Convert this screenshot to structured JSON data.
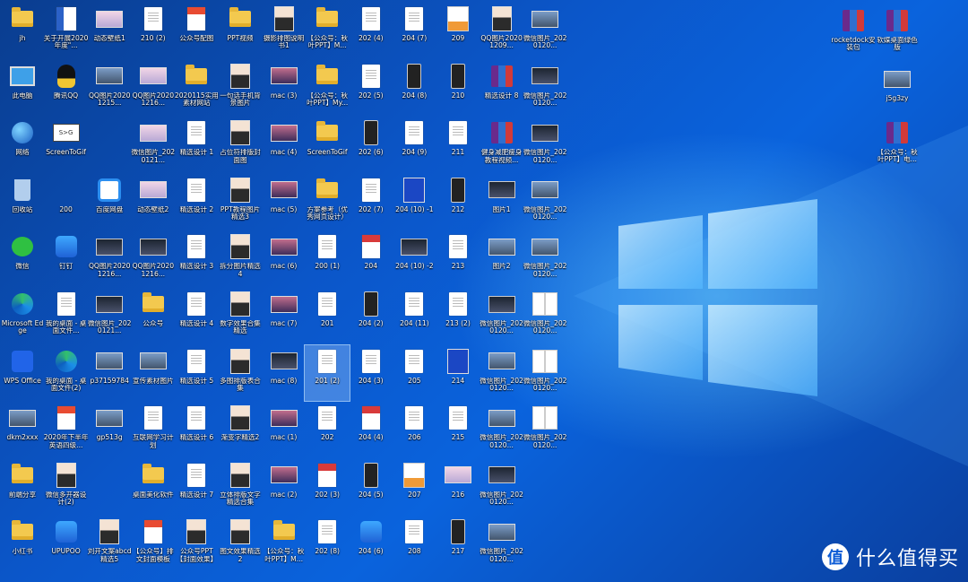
{
  "watermark": {
    "logo_text": "值",
    "text": "什么值得买"
  },
  "desktop": {
    "columns": [
      {
        "x": 0,
        "items": [
          {
            "label": "jh",
            "icon": "folder"
          },
          {
            "label": "此电脑",
            "icon": "pc"
          },
          {
            "label": "网络",
            "icon": "globe"
          },
          {
            "label": "回收站",
            "icon": "recycle"
          },
          {
            "label": "微信",
            "icon": "wechat"
          },
          {
            "label": "Microsoft Edge",
            "icon": "edge"
          },
          {
            "label": "WPS Office",
            "icon": "wpsapp"
          },
          {
            "label": "dkm2xxx",
            "icon": "wide"
          },
          {
            "label": "前端分享",
            "icon": "folder"
          },
          {
            "label": "小红书",
            "icon": "folder"
          }
        ]
      },
      {
        "x": 1,
        "items": [
          {
            "label": "关于开展2020年度\"...",
            "icon": "word"
          },
          {
            "label": "腾讯QQ",
            "icon": "qq"
          },
          {
            "label": "ScreenToGif",
            "icon": "gif"
          },
          {
            "label": "200",
            "icon": "none"
          },
          {
            "label": "钉钉",
            "icon": "app"
          },
          {
            "label": "我的桌面 - 桌面文件...",
            "icon": "doc"
          },
          {
            "label": "我的桌面 - 桌面文件(2)",
            "icon": "edge"
          },
          {
            "label": "2020年下半年英语四级...",
            "icon": "wps"
          },
          {
            "label": "微信多开器设计(2)",
            "icon": "person"
          },
          {
            "label": "UPUPOO",
            "icon": "app"
          }
        ]
      },
      {
        "x": 2,
        "items": [
          {
            "label": "动态壁纸1",
            "icon": "pink"
          },
          {
            "label": "QQ图片2020121​5...",
            "icon": "wide"
          },
          {
            "label": "",
            "icon": "none"
          },
          {
            "label": "百度网盘",
            "icon": "baidu"
          },
          {
            "label": "QQ图片2020121​6...",
            "icon": "dark"
          },
          {
            "label": "微信图片_2020121...",
            "icon": "dark"
          },
          {
            "label": "p37159784",
            "icon": "wide"
          },
          {
            "label": "gp513g",
            "icon": "wide"
          },
          {
            "label": "",
            "icon": "none"
          },
          {
            "label": "刘开文案abcd精选5",
            "icon": "person"
          }
        ]
      },
      {
        "x": 3,
        "items": [
          {
            "label": "210 (2)",
            "icon": "doc"
          },
          {
            "label": "QQ图片2020121​6...",
            "icon": "pink"
          },
          {
            "label": "微信图片_2020121...",
            "icon": "pink"
          },
          {
            "label": "动态壁纸2",
            "icon": "pink"
          },
          {
            "label": "QQ图片2020121​6...",
            "icon": "dark"
          },
          {
            "label": "公众号",
            "icon": "folder"
          },
          {
            "label": "宣传素材图片",
            "icon": "wide"
          },
          {
            "label": "互联网学习计划",
            "icon": "doc"
          },
          {
            "label": "桌面美化软件",
            "icon": "folder"
          },
          {
            "label": "【公众号】排文封面模板",
            "icon": "wps"
          }
        ]
      },
      {
        "x": 4,
        "items": [
          {
            "label": "公众号配图",
            "icon": "wps"
          },
          {
            "label": "2020115实用素材网站",
            "icon": "folder"
          },
          {
            "label": "精选设计 1",
            "icon": "doc"
          },
          {
            "label": "精选设计 2",
            "icon": "doc"
          },
          {
            "label": "精选设计 3",
            "icon": "doc"
          },
          {
            "label": "精选设计 4",
            "icon": "doc"
          },
          {
            "label": "精选设计 5",
            "icon": "doc"
          },
          {
            "label": "精选设计 6",
            "icon": "doc"
          },
          {
            "label": "精选设计 7",
            "icon": "doc"
          },
          {
            "label": "公众号PPT【封面效果】",
            "icon": "person"
          }
        ]
      },
      {
        "x": 5,
        "items": [
          {
            "label": "PPT视频",
            "icon": "folder"
          },
          {
            "label": "一句话手机背景图片",
            "icon": "person"
          },
          {
            "label": "占位符排版封面图",
            "icon": "person"
          },
          {
            "label": "PPT教程图片精选3",
            "icon": "person"
          },
          {
            "label": "拆分图片精选4",
            "icon": "person"
          },
          {
            "label": "数字效果合集精选",
            "icon": "person"
          },
          {
            "label": "多图排版表合集",
            "icon": "person"
          },
          {
            "label": "渐变字精选2",
            "icon": "person"
          },
          {
            "label": "立体排版文字精选合集",
            "icon": "person"
          },
          {
            "label": "图文效果精选2",
            "icon": "person"
          }
        ]
      },
      {
        "x": 6,
        "items": [
          {
            "label": "摄影排图说明书1",
            "icon": "person"
          },
          {
            "label": "mac (3)",
            "icon": "mac"
          },
          {
            "label": "mac (4)",
            "icon": "mac"
          },
          {
            "label": "mac (5)",
            "icon": "mac"
          },
          {
            "label": "mac (6)",
            "icon": "mac"
          },
          {
            "label": "mac (7)",
            "icon": "mac"
          },
          {
            "label": "mac (8)",
            "icon": "dark"
          },
          {
            "label": "mac (1)",
            "icon": "mac"
          },
          {
            "label": "mac (2)",
            "icon": "mac"
          },
          {
            "label": "【公众号：秋叶PPT】M...",
            "icon": "folder"
          }
        ]
      },
      {
        "x": 7,
        "items": [
          {
            "label": "【公众号：秋叶PPT】M...",
            "icon": "folder"
          },
          {
            "label": "【公众号：秋叶PPT】My...",
            "icon": "folder"
          },
          {
            "label": "ScreenToGif",
            "icon": "folder"
          },
          {
            "label": "方案参考（优秀网页设计）",
            "icon": "folder"
          },
          {
            "label": "200 (1)",
            "icon": "doc"
          },
          {
            "label": "201",
            "icon": "doc"
          },
          {
            "label": "201 (2)",
            "icon": "doc",
            "selected": true
          },
          {
            "label": "202",
            "icon": "doc"
          },
          {
            "label": "202 (3)",
            "icon": "red"
          },
          {
            "label": "202 (8)",
            "icon": "doc"
          }
        ]
      },
      {
        "x": 8,
        "items": [
          {
            "label": "202 (4)",
            "icon": "doc"
          },
          {
            "label": "202 (5)",
            "icon": "doc"
          },
          {
            "label": "202 (6)",
            "icon": "phone"
          },
          {
            "label": "202 (7)",
            "icon": "doc"
          },
          {
            "label": "204",
            "icon": "red"
          },
          {
            "label": "204 (2)",
            "icon": "phone"
          },
          {
            "label": "204 (3)",
            "icon": "doc"
          },
          {
            "label": "204 (4)",
            "icon": "red"
          },
          {
            "label": "204 (5)",
            "icon": "phone"
          },
          {
            "label": "204 (6)",
            "icon": "app"
          }
        ]
      },
      {
        "x": 9,
        "items": [
          {
            "label": "204 (7)",
            "icon": "doc"
          },
          {
            "label": "204 (8)",
            "icon": "phone"
          },
          {
            "label": "204 (9)",
            "icon": "doc"
          },
          {
            "label": "204 (10) -1",
            "icon": "blue"
          },
          {
            "label": "204 (10) -2",
            "icon": "dark"
          },
          {
            "label": "204 (11)",
            "icon": "doc"
          },
          {
            "label": "205",
            "icon": "doc"
          },
          {
            "label": "206",
            "icon": "doc"
          },
          {
            "label": "207",
            "icon": "orange"
          },
          {
            "label": "208",
            "icon": "doc"
          }
        ]
      },
      {
        "x": 10,
        "items": [
          {
            "label": "209",
            "icon": "orange"
          },
          {
            "label": "210",
            "icon": "phone"
          },
          {
            "label": "211",
            "icon": "doc"
          },
          {
            "label": "212",
            "icon": "phone"
          },
          {
            "label": "213",
            "icon": "doc"
          },
          {
            "label": "213 (2)",
            "icon": "doc"
          },
          {
            "label": "214",
            "icon": "blue"
          },
          {
            "label": "215",
            "icon": "doc"
          },
          {
            "label": "216",
            "icon": "pink"
          },
          {
            "label": "217",
            "icon": "phone"
          }
        ]
      },
      {
        "x": 11,
        "items": [
          {
            "label": "QQ图片2020120​9...",
            "icon": "person"
          },
          {
            "label": "精选设计 8",
            "icon": "zip"
          },
          {
            "label": "健身减肥瘦身教程视频...",
            "icon": "zip"
          },
          {
            "label": "图片1",
            "icon": "dark"
          },
          {
            "label": "图片2",
            "icon": "wide"
          },
          {
            "label": "微信图片_2020120...",
            "icon": "dark"
          },
          {
            "label": "微信图片_2020120...",
            "icon": "wide"
          },
          {
            "label": "微信图片_2020120...",
            "icon": "wide"
          },
          {
            "label": "微信图片_2020120...",
            "icon": "dark"
          },
          {
            "label": "微信图片_2020120...",
            "icon": "wide"
          }
        ]
      },
      {
        "x": 12,
        "items": [
          {
            "label": "微信图片_2020120...",
            "icon": "wide"
          },
          {
            "label": "微信图片_2020120...",
            "icon": "dark"
          },
          {
            "label": "微信图片_2020120...",
            "icon": "dark"
          },
          {
            "label": "微信图片_2020120...",
            "icon": "wide"
          },
          {
            "label": "微信图片_2020120...",
            "icon": "wide"
          },
          {
            "label": "微信图片_2020120...",
            "icon": "grid"
          },
          {
            "label": "微信图片_2020120...",
            "icon": "grid"
          },
          {
            "label": "微信图片_2020120...",
            "icon": "grid"
          }
        ]
      }
    ],
    "right_items": [
      {
        "label": "rocketdock安装包",
        "icon": "zip"
      },
      {
        "label": "软媒桌面绿色版",
        "icon": "zip"
      },
      {
        "label": "j5g3zy",
        "icon": "wide"
      },
      {
        "label": "【公众号：秋叶PPT】电...",
        "icon": "zip"
      }
    ]
  }
}
